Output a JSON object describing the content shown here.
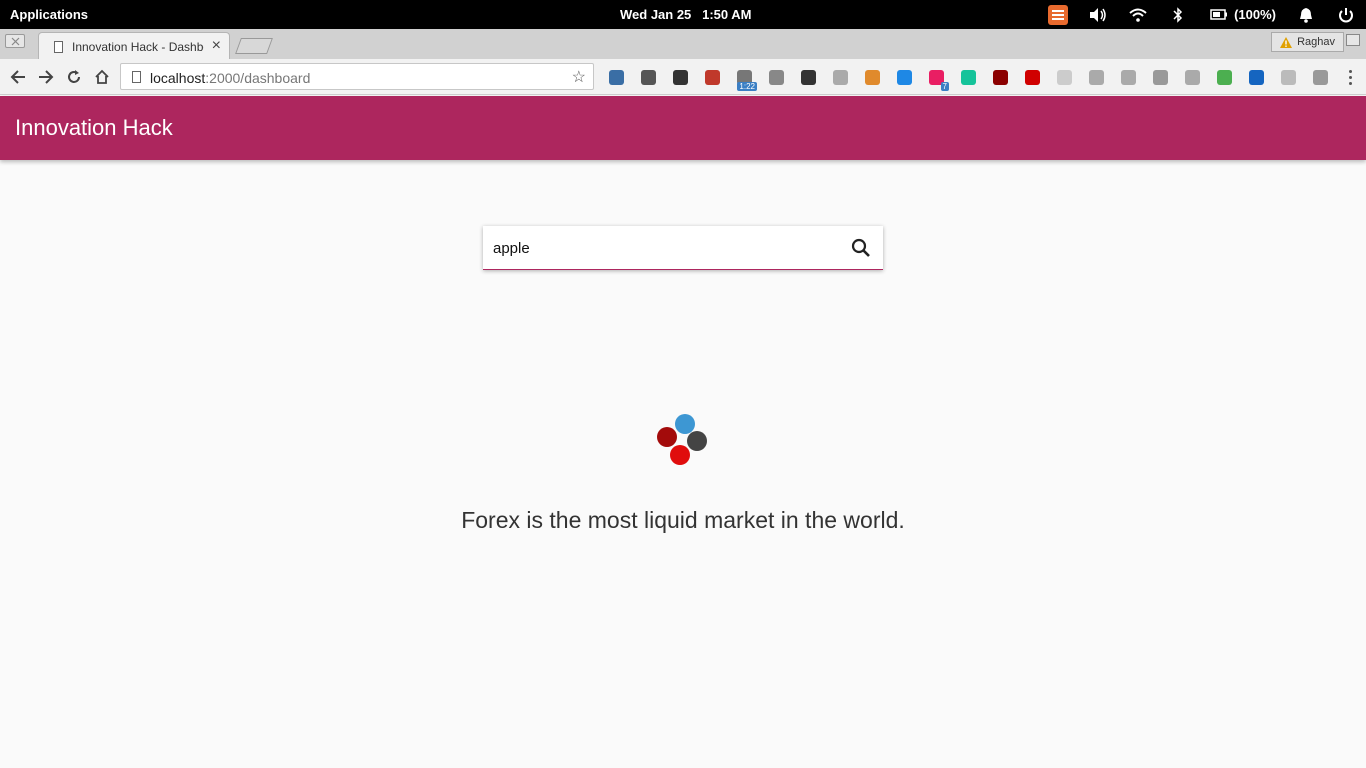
{
  "os": {
    "apps_label": "Applications",
    "clock": "Wed Jan 25   1:50 AM",
    "battery": "(100%)",
    "icons": [
      "media-icon",
      "volume-icon",
      "wifi-icon",
      "bluetooth-icon",
      "battery-icon",
      "bell-icon",
      "power-icon"
    ]
  },
  "browser": {
    "tab_title": "Innovation Hack - Dashboard",
    "profile_name": "Raghav",
    "url_host": "localhost",
    "url_path": ":2000/dashboard",
    "extensions": [
      {
        "name": "ext-inbox-icon",
        "color": "#3a6ea5"
      },
      {
        "name": "ext-eyedropper-icon",
        "color": "#555555"
      },
      {
        "name": "ext-font-icon",
        "color": "#333333"
      },
      {
        "name": "ext-book-icon",
        "color": "#c0392b"
      },
      {
        "name": "ext-timer-icon",
        "color": "#777777",
        "badge": "1:22"
      },
      {
        "name": "ext-code-icon",
        "color": "#888888"
      },
      {
        "name": "ext-pocket-icon",
        "color": "#333333"
      },
      {
        "name": "ext-camera-icon",
        "color": "#aaaaaa"
      },
      {
        "name": "ext-face-icon",
        "color": "#e08a2c"
      },
      {
        "name": "ext-compass-icon",
        "color": "#1e88e5"
      },
      {
        "name": "ext-m-icon",
        "color": "#e91e63",
        "badge": "7"
      },
      {
        "name": "ext-grammarly-icon",
        "color": "#15c39a"
      },
      {
        "name": "ext-spy-icon",
        "color": "#8b0000"
      },
      {
        "name": "ext-adblock-icon",
        "color": "#d00000"
      },
      {
        "name": "ext-card-icon",
        "color": "#cccccc"
      },
      {
        "name": "ext-react-icon",
        "color": "#aaaaaa"
      },
      {
        "name": "ext-help-icon",
        "color": "#aaaaaa"
      },
      {
        "name": "ext-check-icon",
        "color": "#999999"
      },
      {
        "name": "ext-clip-icon",
        "color": "#aaaaaa"
      },
      {
        "name": "ext-rainbow-icon",
        "color": "#4caf50"
      },
      {
        "name": "ext-mail-icon",
        "color": "#1565c0"
      },
      {
        "name": "ext-feather-icon",
        "color": "#bbbbbb"
      },
      {
        "name": "ext-c-icon",
        "color": "#999999"
      }
    ]
  },
  "app": {
    "title": "Innovation Hack",
    "accent": "#ad265e",
    "search": {
      "value": "apple",
      "placeholder": ""
    },
    "fact": "Forex is the most liquid market in the world."
  }
}
